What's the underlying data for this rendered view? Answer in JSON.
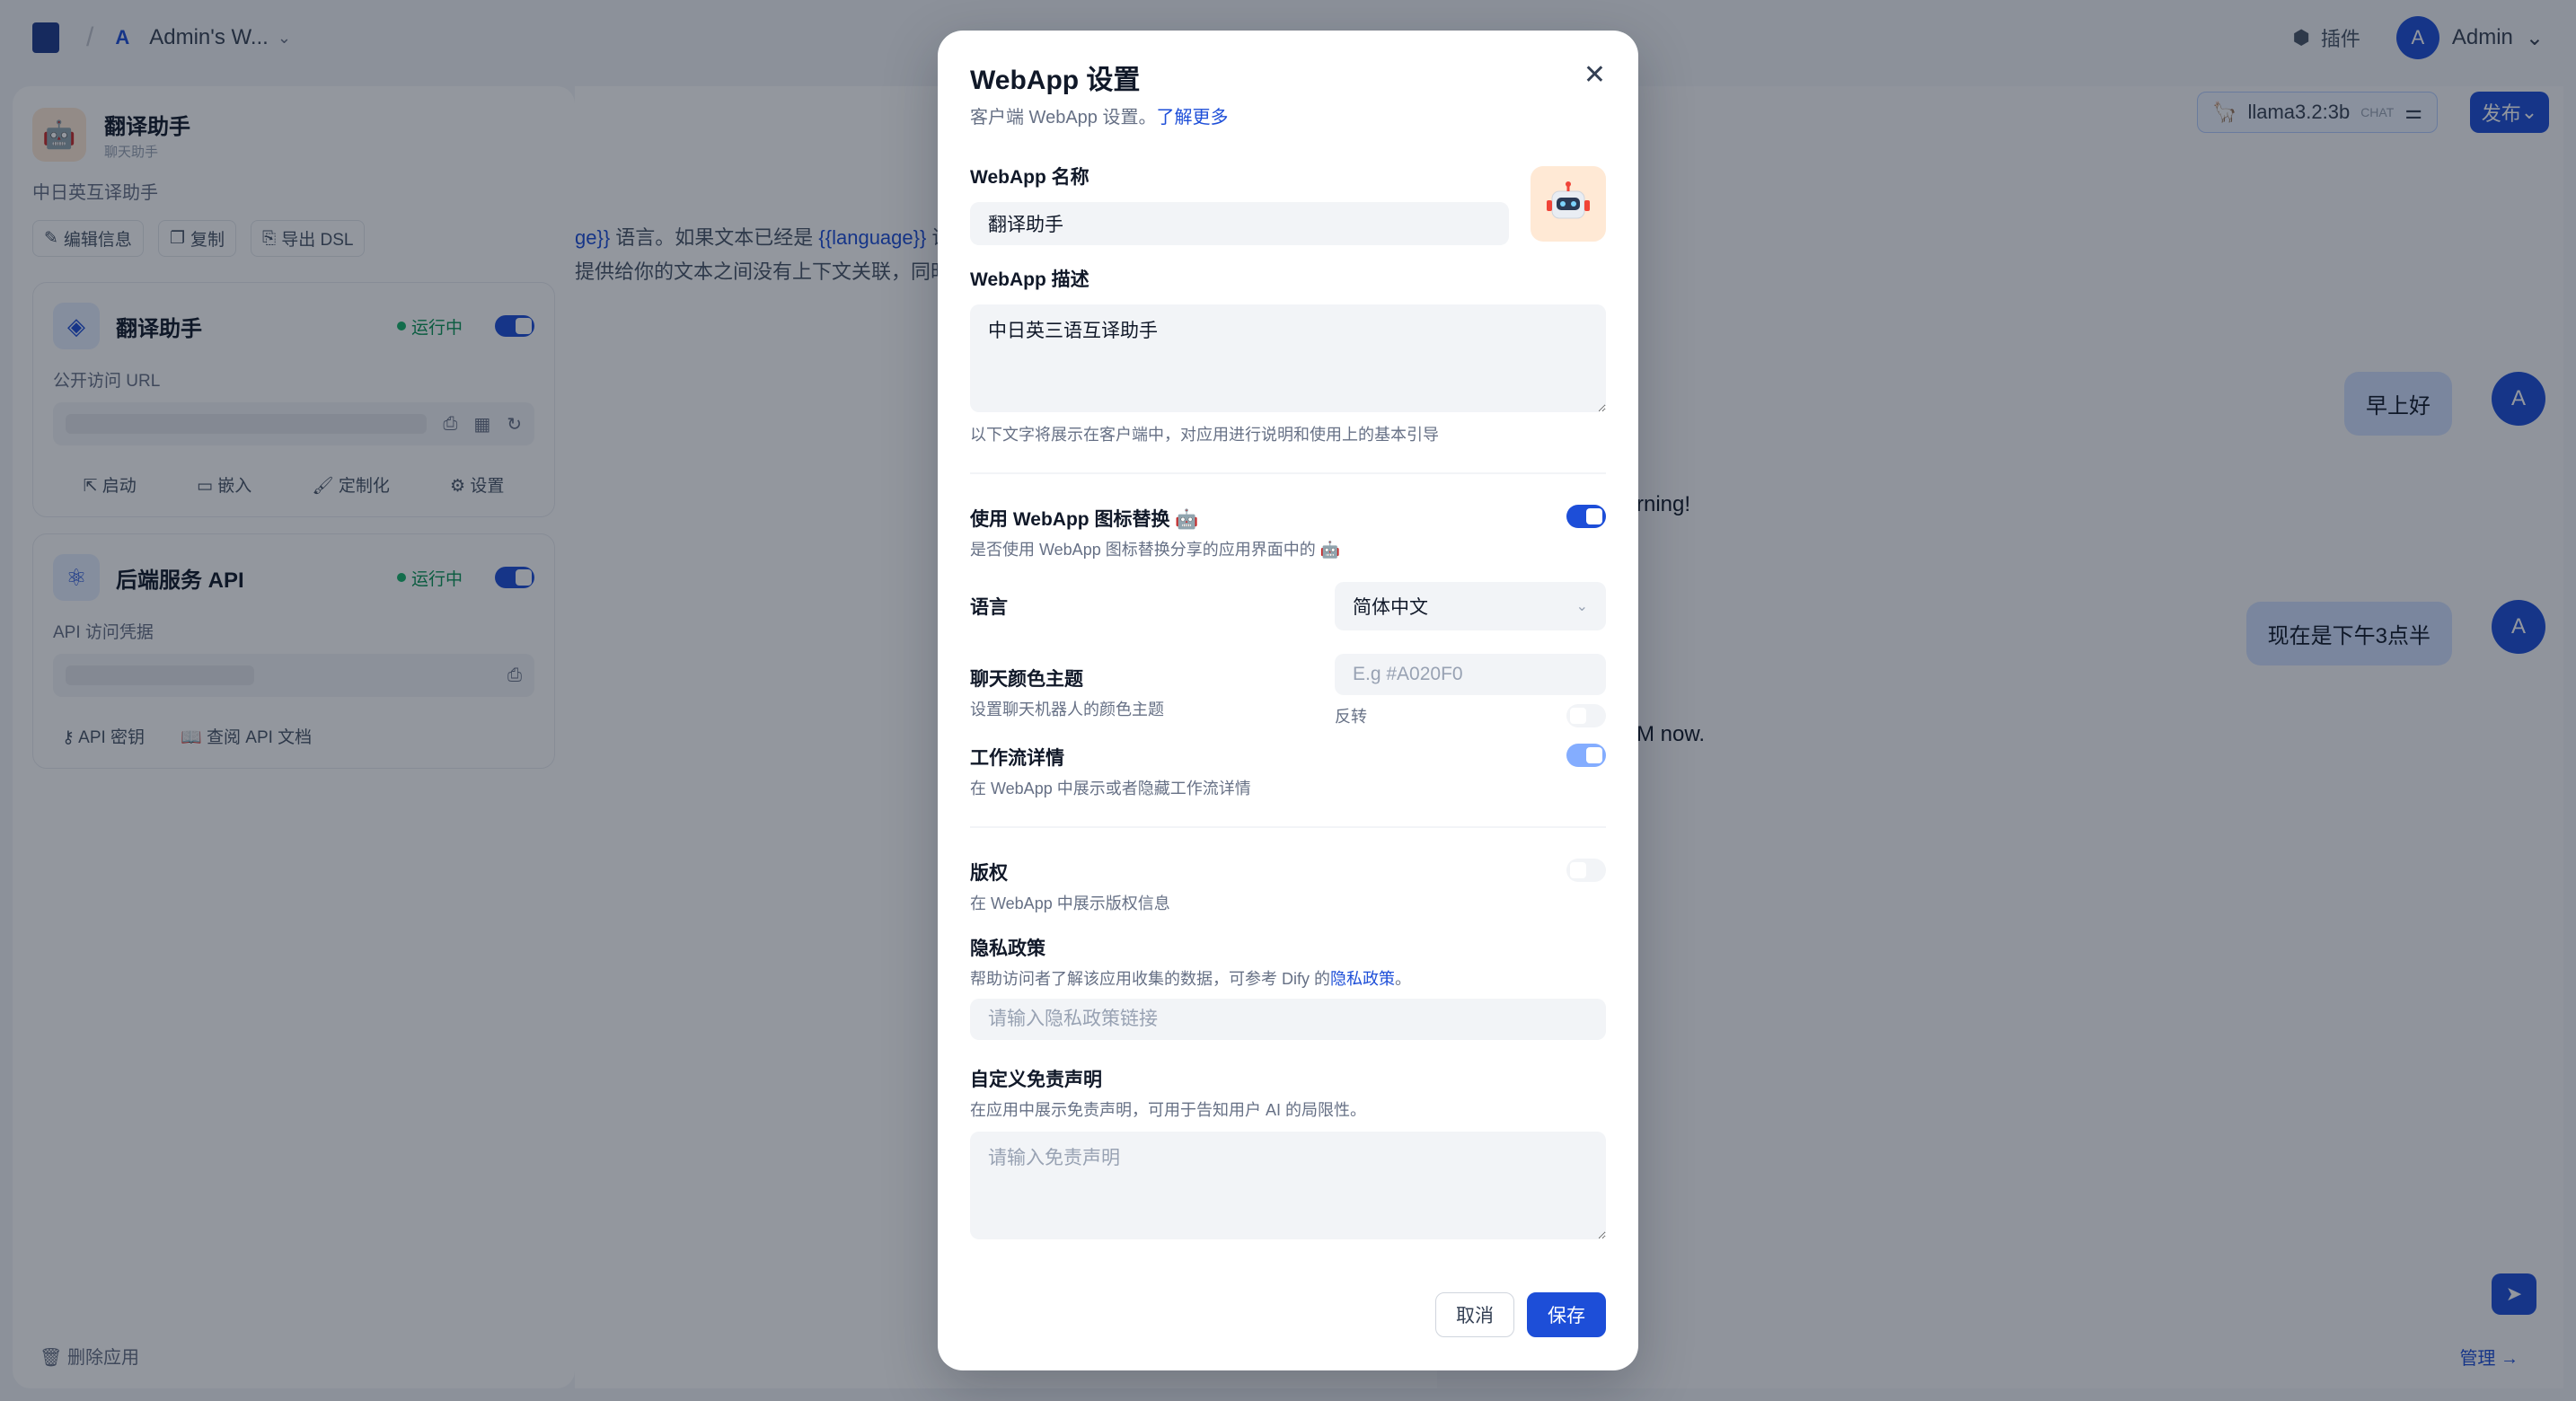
{
  "topbar": {
    "workspace_avatar": "A",
    "workspace_name": "Admin's W...",
    "plugins_label": "插件",
    "user_avatar": "A",
    "user_name": "Admin"
  },
  "left": {
    "app_name": "翻译助手",
    "app_type": "聊天助手",
    "app_desc": "中日英互译助手",
    "actions": [
      "编辑信息",
      "复制",
      "导出 DSL"
    ],
    "webapp_card": {
      "title": "翻译助手",
      "status": "运行中",
      "url_label": "公开访问 URL",
      "actions": [
        "启动",
        "嵌入",
        "定制化",
        "设置"
      ]
    },
    "api_card": {
      "title": "后端服务 API",
      "status": "运行中",
      "cred_label": "API 访问凭据",
      "actions": [
        "API 密钥",
        "查阅 API 文档"
      ]
    },
    "delete_label": "删除应用"
  },
  "center": {
    "prompt_fragment_1_var": "ge}}",
    "prompt_fragment_1_text": " 语言。如果文本已经是 ",
    "prompt_fragment_1_var2": "{{language}}",
    "prompt_fragment_1_tail": " 语言，",
    "prompt_fragment_2": "提供给你的文本之间没有上下文关联，同时你确"
  },
  "right": {
    "model_name": "llama3.2:3b",
    "model_tag": "CHAT",
    "publish_label": "发布",
    "messages": [
      {
        "role": "user",
        "text": "早上好"
      },
      {
        "role": "bot",
        "text": "rning!"
      },
      {
        "role": "user",
        "text": "现在是下午3点半"
      },
      {
        "role": "bot",
        "text": "M now."
      }
    ],
    "user_avatar": "A",
    "manage_label": "管理"
  },
  "modal": {
    "title": "WebApp 设置",
    "subtitle": "客户端 WebApp 设置。",
    "learn_more": "了解更多",
    "name_label": "WebApp 名称",
    "name_value": "翻译助手",
    "desc_label": "WebApp 描述",
    "desc_value": "中日英三语互译助手",
    "desc_help": "以下文字将展示在客户端中，对应用进行说明和使用上的基本引导",
    "icon_replace_label": "使用 WebApp 图标替换",
    "icon_replace_help": "是否使用 WebApp 图标替换分享的应用界面中的",
    "icon_replace_enabled": true,
    "language_label": "语言",
    "language_value": "简体中文",
    "theme_label": "聊天颜色主题",
    "theme_help": "设置聊天机器人的颜色主题",
    "theme_placeholder": "E.g #A020F0",
    "invert_label": "反转",
    "invert_enabled": false,
    "workflow_label": "工作流详情",
    "workflow_help": "在 WebApp 中展示或者隐藏工作流详情",
    "workflow_enabled": true,
    "copyright_label": "版权",
    "copyright_help": "在 WebApp 中展示版权信息",
    "copyright_enabled": false,
    "privacy_label": "隐私政策",
    "privacy_help_prefix": "帮助访问者了解该应用收集的数据，可参考 Dify 的",
    "privacy_help_link": "隐私政策",
    "privacy_help_suffix": "。",
    "privacy_placeholder": "请输入隐私政策链接",
    "disclaimer_label": "自定义免责声明",
    "disclaimer_help": "在应用中展示免责声明，可用于告知用户 AI 的局限性。",
    "disclaimer_placeholder": "请输入免责声明",
    "cancel_label": "取消",
    "save_label": "保存"
  },
  "colors": {
    "accent": "#1d4ed8",
    "overlay": "rgba(16,24,40,0.45)"
  }
}
